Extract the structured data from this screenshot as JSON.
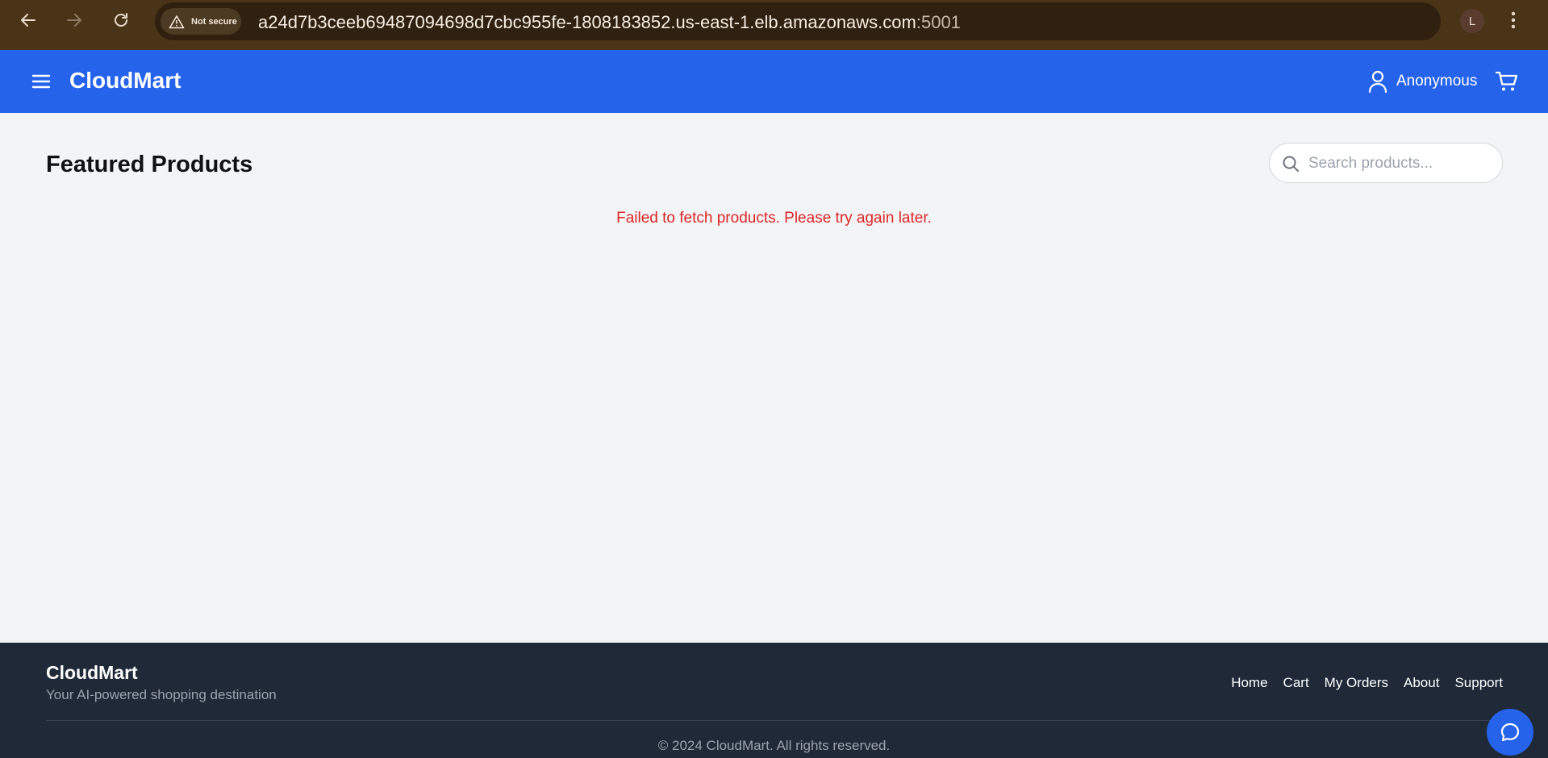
{
  "browser": {
    "not_secure_label": "Not secure",
    "url_host": "a24d7b3ceeb69487094698d7cbc955fe-1808183852.us-east-1.elb.amazonaws.com",
    "url_port": ":5001",
    "profile_initial": "L"
  },
  "header": {
    "brand": "CloudMart",
    "user_name": "Anonymous",
    "accent_color": "#2563eb"
  },
  "main": {
    "title": "Featured Products",
    "search_placeholder": "Search products...",
    "error_message": "Failed to fetch products. Please try again later.",
    "error_color": "#dc2626"
  },
  "footer": {
    "brand": "CloudMart",
    "tagline": "Your AI-powered shopping destination",
    "links": [
      "Home",
      "Cart",
      "My Orders",
      "About",
      "Support"
    ],
    "copyright": "© 2024 CloudMart. All rights reserved."
  },
  "icons": {
    "back": "arrow-left-icon",
    "forward": "arrow-right-icon",
    "reload": "reload-icon",
    "warning": "warning-icon",
    "star": "star-icon",
    "kebab": "kebab-menu-icon",
    "menu": "hamburger-menu-icon",
    "user": "user-icon",
    "cart": "cart-icon",
    "search": "search-icon",
    "chat": "chat-icon"
  }
}
